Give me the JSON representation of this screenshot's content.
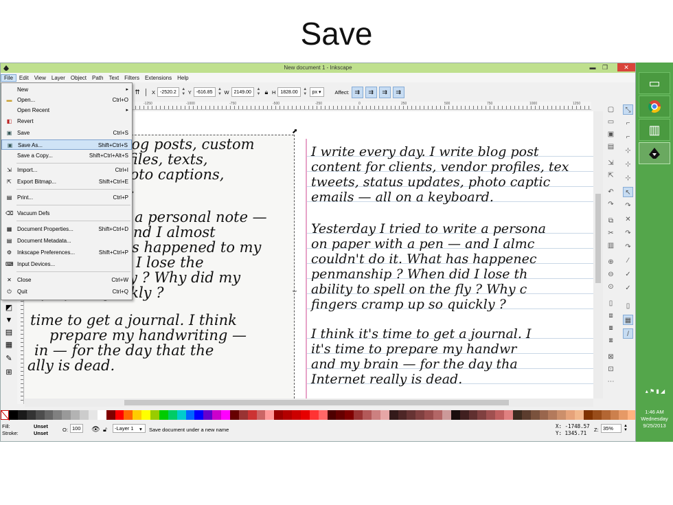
{
  "slide": {
    "title": "Save"
  },
  "window": {
    "title": "New document 1 - Inkscape",
    "controls": {
      "minimize": "▬",
      "maximize": "❐",
      "close": "✕"
    }
  },
  "menubar": [
    "File",
    "Edit",
    "View",
    "Layer",
    "Object",
    "Path",
    "Text",
    "Filters",
    "Extensions",
    "Help"
  ],
  "toolbar": {
    "x_label": "X",
    "x_value": "-2520.2",
    "y_label": "Y",
    "y_value": "-616.85",
    "w_label": "W",
    "w_value": "2149.00",
    "h_label": "H",
    "h_value": "1828.00",
    "unit": "px",
    "affect_label": "Affect:"
  },
  "ruler_ticks": [
    "-1250",
    "-1000",
    "-750",
    "-500",
    "-250",
    "0",
    "250",
    "500",
    "750",
    "1000",
    "1250"
  ],
  "file_menu": {
    "items": [
      {
        "label": "New",
        "shortcut": "",
        "submenu": true,
        "icon": "new-icon"
      },
      {
        "label": "Open...",
        "shortcut": "Ctrl+O",
        "submenu": false,
        "icon": "open-folder-icon"
      },
      {
        "label": "Open Recent",
        "shortcut": "",
        "submenu": true,
        "icon": ""
      },
      {
        "label": "Revert",
        "shortcut": "",
        "submenu": false,
        "icon": "revert-icon"
      },
      {
        "label": "Save",
        "shortcut": "Ctrl+S",
        "submenu": false,
        "icon": "save-icon"
      },
      {
        "label": "Save As...",
        "shortcut": "Shift+Ctrl+S",
        "submenu": false,
        "icon": "save-as-icon",
        "highlighted": true
      },
      {
        "label": "Save a Copy...",
        "shortcut": "Shift+Ctrl+Alt+S",
        "submenu": false,
        "icon": ""
      },
      {
        "label": "Import...",
        "shortcut": "Ctrl+I",
        "submenu": false,
        "icon": "import-icon"
      },
      {
        "label": "Export Bitmap...",
        "shortcut": "Shift+Ctrl+E",
        "submenu": false,
        "icon": "export-icon"
      },
      {
        "label": "Print...",
        "shortcut": "Ctrl+P",
        "submenu": false,
        "icon": "print-icon"
      },
      {
        "label": "Vacuum Defs",
        "shortcut": "",
        "submenu": false,
        "icon": "vacuum-icon"
      },
      {
        "label": "Document Properties...",
        "shortcut": "Shift+Ctrl+D",
        "submenu": false,
        "icon": "document-properties-icon"
      },
      {
        "label": "Document Metadata...",
        "shortcut": "",
        "submenu": false,
        "icon": "metadata-icon"
      },
      {
        "label": "Inkscape Preferences...",
        "shortcut": "Shift+Ctrl+P",
        "submenu": false,
        "icon": "preferences-icon"
      },
      {
        "label": "Input Devices...",
        "shortcut": "",
        "submenu": false,
        "icon": "input-devices-icon"
      },
      {
        "label": "Close",
        "shortcut": "Ctrl+W",
        "submenu": false,
        "icon": "close-icon"
      },
      {
        "label": "Quit",
        "shortcut": "Ctrl+Q",
        "submenu": false,
        "icon": "quit-icon"
      }
    ]
  },
  "canvas": {
    "left_page_lines": [
      "e blog posts, custom",
      "rofiles, texts,",
      "hoto captions,",
      "d.",
      "a personal note —",
      "nd I almost",
      "s happened to my",
      "I lose the",
      "y ? Why did my",
      "mp up so quickly ?",
      "time to get a journal. I think",
      "prepare my handwriting —",
      "in — for the day that the",
      "ally is dead."
    ],
    "right_page_lines": [
      "I write every day. I write blog post",
      "content for clients, vendor profiles, tex",
      "tweets, status updates, photo captic",
      "emails — all on a keyboard.",
      "Yesterday I tried to write a persona",
      "on paper with a pen — and I almc",
      "couldn't do it. What has happenec",
      "penmanship ? When did I lose th",
      "ability to spell on the fly ? Why c",
      "fingers cramp up so quickly ?",
      "I think it's time to get a journal. I",
      "it's time to prepare my handwr",
      "and my brain — for the day tha",
      "Internet really is dead."
    ]
  },
  "palette": [
    "#000000",
    "#1a1a1a",
    "#333333",
    "#4d4d4d",
    "#666666",
    "#808080",
    "#999999",
    "#b3b3b3",
    "#cccccc",
    "#e6e6e6",
    "#ffffff",
    "#800000",
    "#ff0000",
    "#ff6600",
    "#ffcc00",
    "#ffff00",
    "#99cc00",
    "#00cc00",
    "#00cc66",
    "#00cccc",
    "#0066ff",
    "#0000ff",
    "#6600cc",
    "#cc00cc",
    "#ff00ff",
    "#660000",
    "#993333",
    "#cc3333",
    "#cc6666",
    "#ff9999",
    "#990000",
    "#b30000",
    "#cc0000",
    "#e60000",
    "#ff3333",
    "#ff6666",
    "#4d0000",
    "#660000",
    "#800000",
    "#993333",
    "#b35959",
    "#cc8080",
    "#e6a6a6",
    "#331a1a",
    "#4d2626",
    "#663333",
    "#804040",
    "#994d4d",
    "#b36666",
    "#cc9999",
    "#1a0d0d",
    "#402020",
    "#603030",
    "#804040",
    "#a05050",
    "#c06060",
    "#e08080",
    "#3d2b1f",
    "#5c3d2e",
    "#7a523d",
    "#99664d",
    "#b37a5c",
    "#cc8f6b",
    "#e6a37a",
    "#f2b88c",
    "#803300",
    "#994d1a",
    "#b36633",
    "#cc804d",
    "#e69966",
    "#ffb380"
  ],
  "statusbar": {
    "fill_label": "Fill:",
    "fill_value": "Unset",
    "stroke_label": "Stroke:",
    "stroke_value": "Unset",
    "opacity_label": "O:",
    "opacity_value": "100",
    "layer_value": "-Layer 1",
    "message": "Save document under a new name",
    "x_coord": "X: -1748.57",
    "y_coord": "Y: 1345.71",
    "zoom_label": "Z:",
    "zoom_value": "35%"
  },
  "taskbar": {
    "time": "1:46 AM",
    "day": "Wednesday",
    "date": "9/25/2013"
  }
}
